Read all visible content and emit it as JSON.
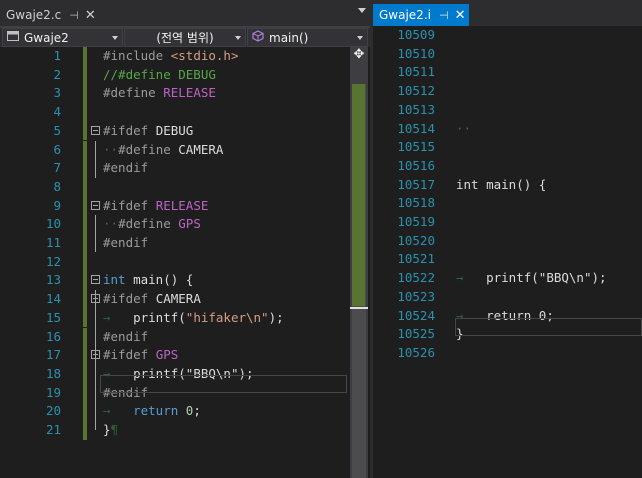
{
  "left_pane": {
    "tab": {
      "title": "Gwaje2.c",
      "pin": "⊣",
      "close": "✕"
    },
    "navbar": {
      "project": "Gwaje2",
      "scope": "(전역 범위)",
      "member": "main()"
    },
    "lines": [
      {
        "n": "1",
        "tokens": [
          {
            "t": "#include",
            "c": "kg"
          },
          {
            "t": " "
          },
          {
            "t": "<stdio.h>",
            "c": "s"
          }
        ]
      },
      {
        "n": "2",
        "tokens": [
          {
            "t": "//#define DEBUG",
            "c": "c"
          }
        ]
      },
      {
        "n": "3",
        "tokens": [
          {
            "t": "#define",
            "c": "kg"
          },
          {
            "t": " "
          },
          {
            "t": "RELEASE",
            "c": "m"
          }
        ]
      },
      {
        "n": "4",
        "tokens": []
      },
      {
        "n": "5",
        "fold": true,
        "tokens": [
          {
            "t": "#ifdef",
            "c": "kg"
          },
          {
            "t": " "
          },
          {
            "t": "DEBUG",
            "c": "i"
          }
        ]
      },
      {
        "n": "6",
        "tokens": [
          {
            "t": "··",
            "c": "ws"
          },
          {
            "t": "#define",
            "c": "kg"
          },
          {
            "t": " "
          },
          {
            "t": "CAMERA",
            "c": "i"
          }
        ]
      },
      {
        "n": "7",
        "tokens": [
          {
            "t": "#endif",
            "c": "kg"
          }
        ]
      },
      {
        "n": "8",
        "tokens": []
      },
      {
        "n": "9",
        "fold": true,
        "tokens": [
          {
            "t": "#ifdef",
            "c": "kg"
          },
          {
            "t": " "
          },
          {
            "t": "RELEASE",
            "c": "m"
          }
        ]
      },
      {
        "n": "10",
        "tokens": [
          {
            "t": "··",
            "c": "ws"
          },
          {
            "t": "#define",
            "c": "kg"
          },
          {
            "t": " "
          },
          {
            "t": "GPS",
            "c": "m"
          }
        ]
      },
      {
        "n": "11",
        "tokens": [
          {
            "t": "#endif",
            "c": "kg"
          }
        ]
      },
      {
        "n": "12",
        "tokens": []
      },
      {
        "n": "13",
        "fold": true,
        "tokens": [
          {
            "t": "int",
            "c": "k"
          },
          {
            "t": " main() {"
          }
        ]
      },
      {
        "n": "14",
        "fold": true,
        "tokens": [
          {
            "t": "#ifdef",
            "c": "kg"
          },
          {
            "t": " "
          },
          {
            "t": "CAMERA",
            "c": "i"
          }
        ]
      },
      {
        "n": "15",
        "tokens": [
          {
            "t": "→",
            "c": "ar"
          },
          {
            "t": "   printf("
          },
          {
            "t": "\"hifaker\\n\"",
            "c": "s"
          },
          {
            "t": ");"
          }
        ]
      },
      {
        "n": "16",
        "tokens": [
          {
            "t": "#endif",
            "c": "kg"
          }
        ]
      },
      {
        "n": "17",
        "fold": true,
        "tokens": [
          {
            "t": "#ifdef",
            "c": "kg"
          },
          {
            "t": " "
          },
          {
            "t": "GPS",
            "c": "m"
          }
        ]
      },
      {
        "n": "18",
        "tokens": [
          {
            "t": "→",
            "c": "ar"
          },
          {
            "t": "   printf("
          },
          {
            "t": "\"BBQ\\n\"",
            "c": "i"
          },
          {
            "t": ");"
          }
        ]
      },
      {
        "n": "19",
        "tokens": [
          {
            "t": "#endif",
            "c": "kg"
          }
        ]
      },
      {
        "n": "20",
        "tokens": [
          {
            "t": "→",
            "c": "ar"
          },
          {
            "t": "   "
          },
          {
            "t": "return",
            "c": "k"
          },
          {
            "t": " "
          },
          {
            "t": "0",
            "c": "n"
          },
          {
            "t": ";"
          }
        ]
      },
      {
        "n": "21",
        "tokens": [
          {
            "t": "}"
          },
          {
            "t": "¶",
            "c": "ar"
          }
        ]
      }
    ]
  },
  "right_pane": {
    "tab": {
      "title": "Gwaje2.i",
      "pin": "⊣",
      "close": "✕"
    },
    "lines": [
      {
        "n": "10509",
        "tokens": []
      },
      {
        "n": "10510",
        "tokens": []
      },
      {
        "n": "10511",
        "tokens": []
      },
      {
        "n": "10512",
        "tokens": []
      },
      {
        "n": "10513",
        "tokens": []
      },
      {
        "n": "10514",
        "tokens": [
          {
            "t": "··",
            "c": "ws"
          }
        ]
      },
      {
        "n": "10515",
        "tokens": []
      },
      {
        "n": "10516",
        "tokens": []
      },
      {
        "n": "10517",
        "tokens": [
          {
            "t": "int main() {"
          }
        ]
      },
      {
        "n": "10518",
        "tokens": []
      },
      {
        "n": "10519",
        "tokens": []
      },
      {
        "n": "10520",
        "tokens": []
      },
      {
        "n": "10521",
        "tokens": []
      },
      {
        "n": "10522",
        "tokens": [
          {
            "t": "→",
            "c": "ar"
          },
          {
            "t": "   printf(\"BBQ\\n\");"
          }
        ]
      },
      {
        "n": "10523",
        "tokens": []
      },
      {
        "n": "10524",
        "tokens": [
          {
            "t": "→",
            "c": "ar"
          },
          {
            "t": "   return 0;"
          }
        ]
      },
      {
        "n": "10525",
        "tokens": [
          {
            "t": "}"
          }
        ]
      },
      {
        "n": "10526",
        "tokens": []
      }
    ]
  },
  "icons": {
    "project": "c-file-icon",
    "member": "method-cube-icon",
    "splitter": "window-split-icon",
    "tab_menu": "dropdown-arrow-icon"
  },
  "colors": {
    "accent": "#007acc",
    "editor_bg": "#1e1e1e",
    "line_number": "#2b91af",
    "change_bar": "#577430"
  },
  "active_line": {
    "left": "21",
    "right": "10526"
  }
}
